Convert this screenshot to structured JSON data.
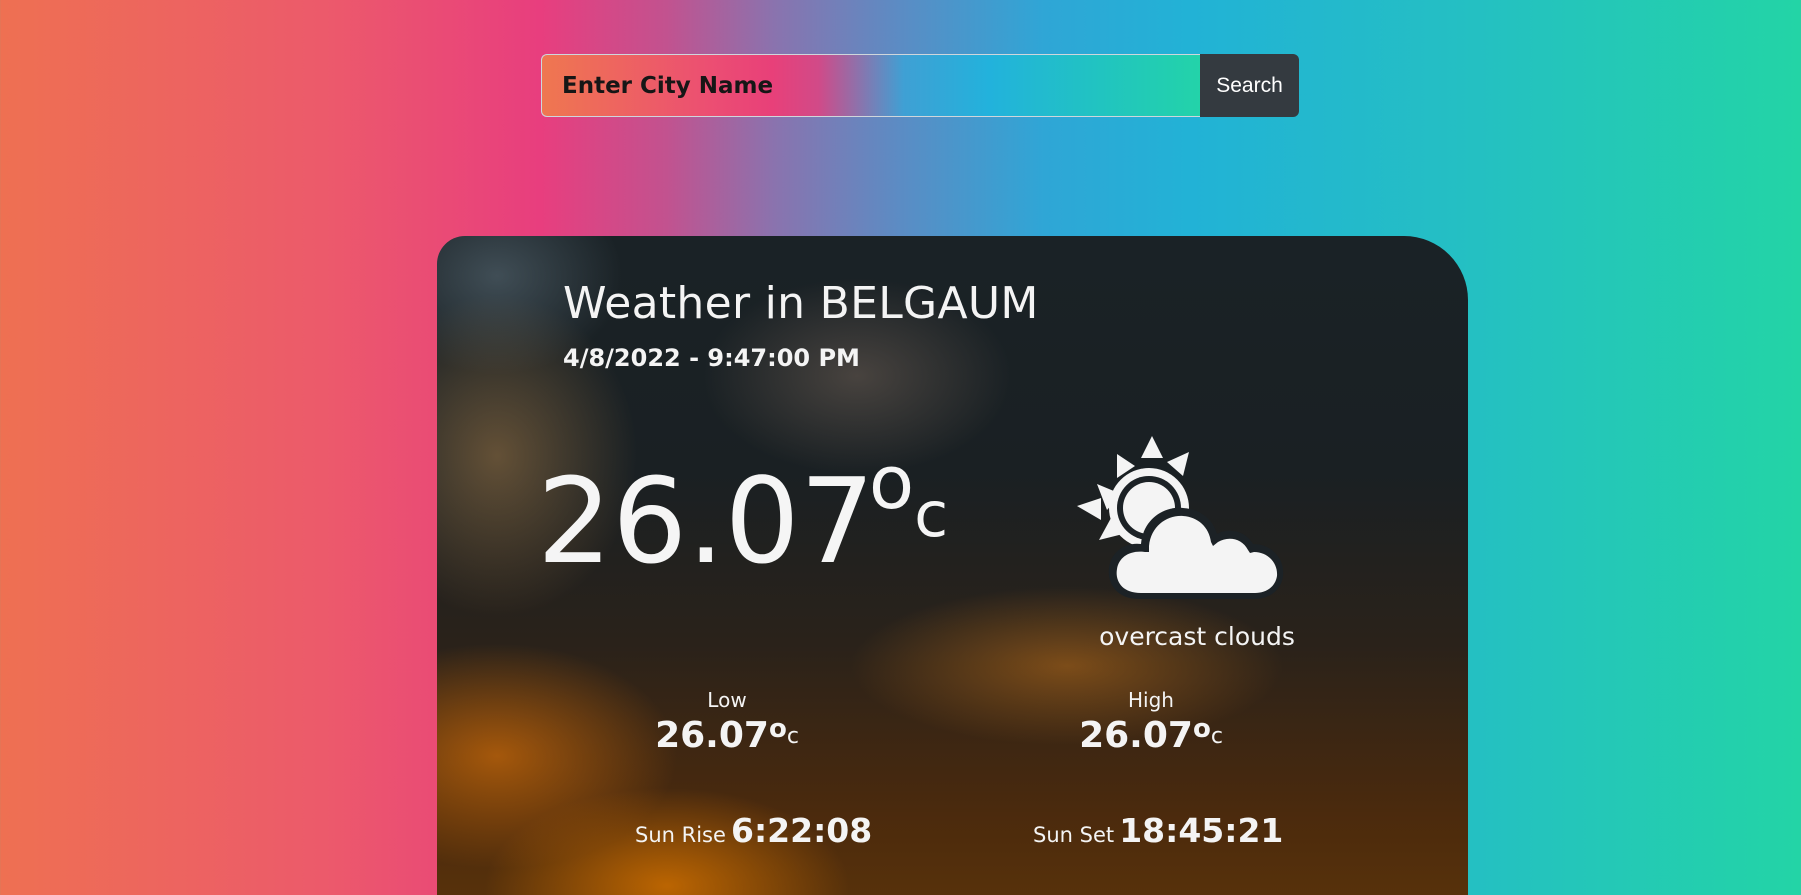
{
  "search": {
    "placeholder": "Enter City Name",
    "button_label": "Search"
  },
  "weather": {
    "title": "Weather in BELGAUM",
    "datetime": "4/8/2022 - 9:47:00 PM",
    "temperature": "26.07",
    "degree_symbol": "o",
    "unit": "c",
    "condition": "overcast clouds",
    "icon": "partly-cloudy-sun-icon",
    "low": {
      "label": "Low",
      "value": "26.07"
    },
    "high": {
      "label": "High",
      "value": "26.07"
    },
    "sunrise": {
      "label": "Sun Rise",
      "value": "6:22:08"
    },
    "sunset": {
      "label": "Sun Set",
      "value": "18:45:21"
    }
  }
}
